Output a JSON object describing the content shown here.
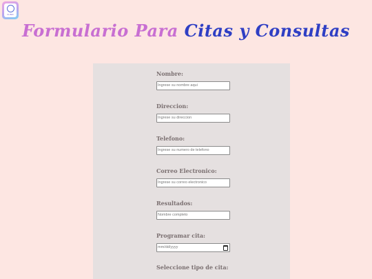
{
  "title": {
    "part1": "Formulario Para",
    "part2": "Citas y Consultas"
  },
  "logo": {
    "icon": "clinic-logo-icon",
    "text": "CLINIC"
  },
  "form": {
    "fields": [
      {
        "label": "Nombre:",
        "placeholder": "Ingrese su nombre aqui"
      },
      {
        "label": "Direccion:",
        "placeholder": "Ingrese su direccion"
      },
      {
        "label": "Telefono:",
        "placeholder": "Ingrese su numero de telefono"
      },
      {
        "label": "Correo Electronico:",
        "placeholder": "Ingrese su correo electronico"
      },
      {
        "label": "Resultados:",
        "placeholder": "Nombre completo"
      },
      {
        "label": "Programar cita:",
        "placeholder": "mm/dd/yyyy"
      },
      {
        "label": "Seleccione tipo de cita:"
      }
    ]
  },
  "colors": {
    "background": "#fde6e2",
    "panel": "#e5e0e0",
    "title_pink": "#c86fd2",
    "title_blue": "#2f3fc4",
    "label": "#7a6f70"
  }
}
